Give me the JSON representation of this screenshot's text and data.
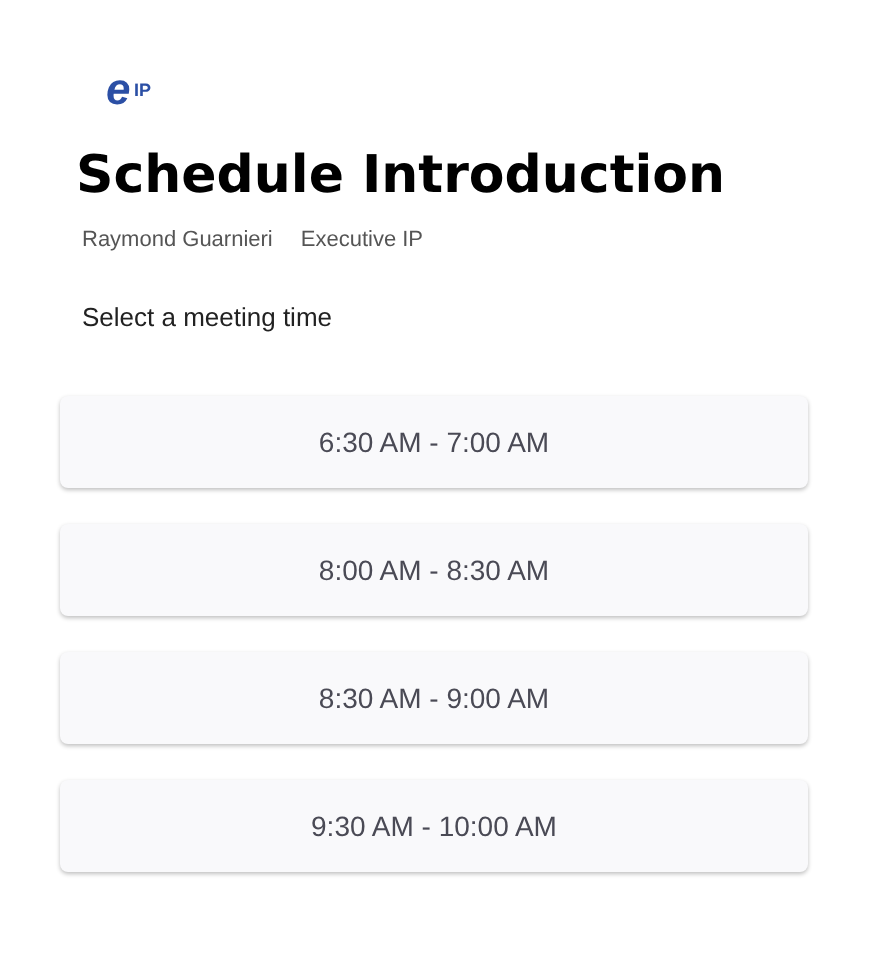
{
  "logo": {
    "letter": "e",
    "suffix": "IP"
  },
  "title": "Schedule Introduction",
  "meta": [
    "Raymond Guarnieri",
    "Executive IP"
  ],
  "prompt": "Select a meeting time",
  "slots": [
    "6:30 AM - 7:00 AM",
    "8:00 AM - 8:30 AM",
    "8:30 AM - 9:00 AM",
    "9:30 AM - 10:00 AM"
  ]
}
